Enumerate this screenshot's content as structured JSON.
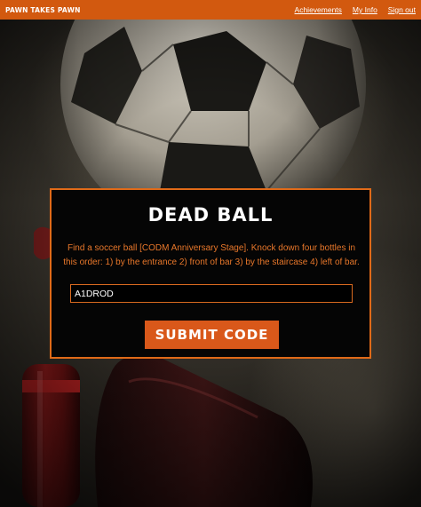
{
  "header": {
    "brand": "PAWN TAKES PAWN",
    "nav": [
      {
        "label": "Achievements"
      },
      {
        "label": "My Info"
      },
      {
        "label": "Sign out"
      }
    ]
  },
  "modal": {
    "title": "DEAD BALL",
    "description": "Find a soccer ball [CODM Anniversary Stage]. Knock down four bottles in this order: 1) by the entrance 2) front of bar 3) by the staircase 4) left of bar.",
    "code_value": "A1DROD",
    "submit_label": "SUBMIT CODE"
  },
  "colors": {
    "accent": "#d2590f",
    "modal_bg": "#050505",
    "text_orange": "#e8772a"
  }
}
